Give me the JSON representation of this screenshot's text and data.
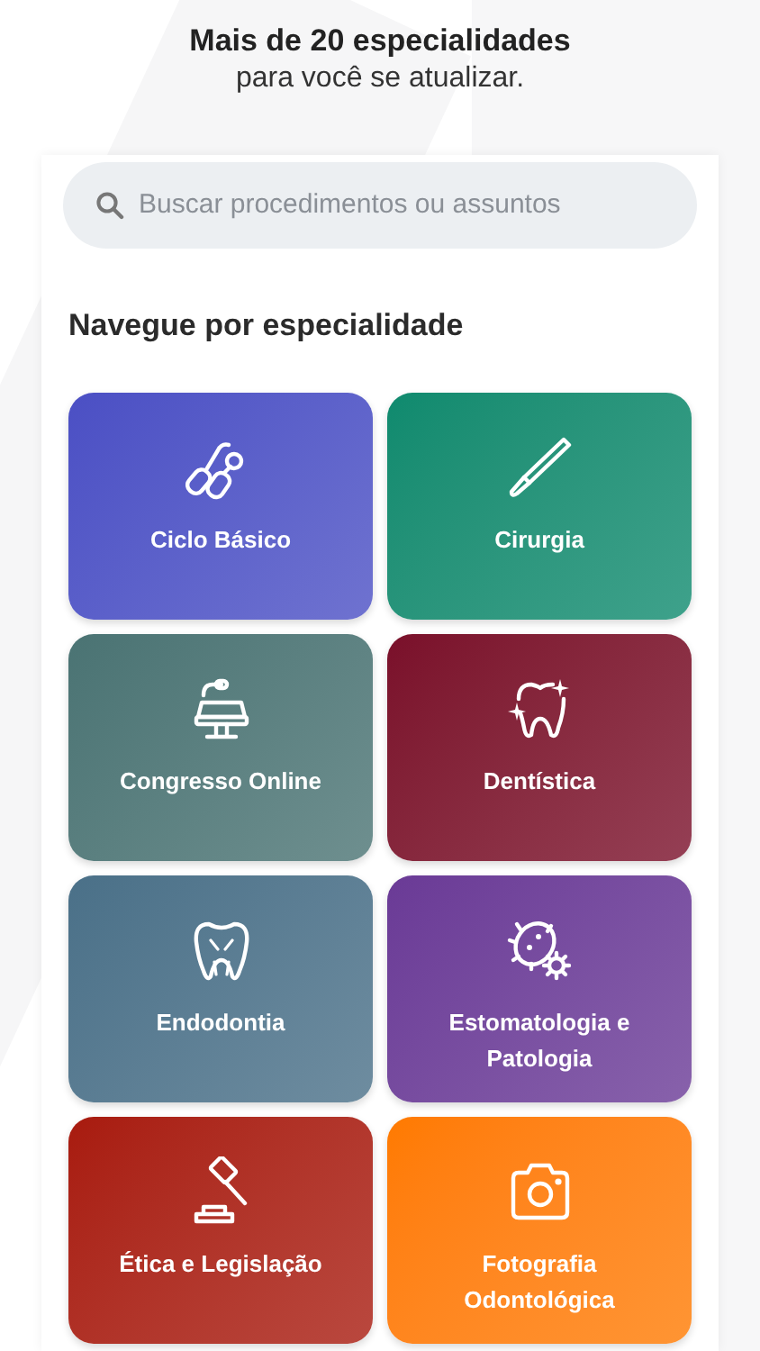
{
  "header": {
    "title": "Mais de 20 especialidades",
    "subtitle": "para você se atualizar."
  },
  "search": {
    "placeholder": "Buscar procedimentos ou assuntos"
  },
  "section_title": "Navegue por especialidade",
  "specialties": [
    {
      "label": "Ciclo Básico",
      "color": "#4b4fc4"
    },
    {
      "label": "Cirurgia",
      "color": "#0e8a6e"
    },
    {
      "label": "Congresso Online",
      "color": "#4a7373"
    },
    {
      "label": "Dentística",
      "color": "#7a0f2a"
    },
    {
      "label": "Endodontia",
      "color": "#4a7088"
    },
    {
      "label": "Estomatologia e Patologia",
      "color": "#6a3a96"
    },
    {
      "label": "Ética e Legislação",
      "color": "#a81a0e"
    },
    {
      "label": "Fotografia Odontológica",
      "color": "#ff7a00"
    }
  ]
}
